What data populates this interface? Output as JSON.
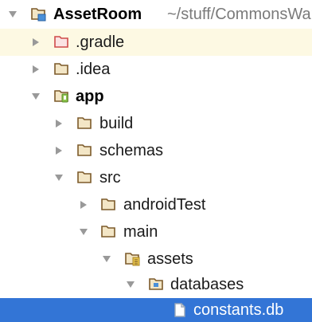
{
  "colors": {
    "arrow": "#999999",
    "folder_outline": "#7c5a2a",
    "folder_fill": "#f3e6c6",
    "gradle_folder": "#cf4a4a",
    "module_badge": "#4a90d9",
    "android_green": "#8bc34a",
    "resource_yellow": "#e6c34a",
    "selection": "#3375d6",
    "highlight_row": "#fdf9e3",
    "secondary_text": "#7a7a7a"
  },
  "tree": {
    "root": {
      "label": "AssetRoom",
      "path": "~/stuff/CommonsWare",
      "icon": "project-folder-icon",
      "expanded": true
    },
    "items": [
      {
        "label": ".gradle",
        "icon": "gradle-folder-icon",
        "expanded": false
      },
      {
        "label": ".idea",
        "icon": "folder-icon",
        "expanded": false
      },
      {
        "label": "app",
        "icon": "android-module-folder-icon",
        "expanded": true
      },
      {
        "label": "build",
        "icon": "folder-icon",
        "expanded": false
      },
      {
        "label": "schemas",
        "icon": "folder-icon",
        "expanded": false
      },
      {
        "label": "src",
        "icon": "folder-icon",
        "expanded": true
      },
      {
        "label": "androidTest",
        "icon": "folder-icon",
        "expanded": false
      },
      {
        "label": "main",
        "icon": "folder-icon",
        "expanded": true
      },
      {
        "label": "assets",
        "icon": "resource-folder-icon",
        "expanded": true
      },
      {
        "label": "databases",
        "icon": "package-folder-icon",
        "expanded": true
      },
      {
        "label": "constants.db",
        "icon": "file-icon",
        "selected": true
      }
    ]
  }
}
